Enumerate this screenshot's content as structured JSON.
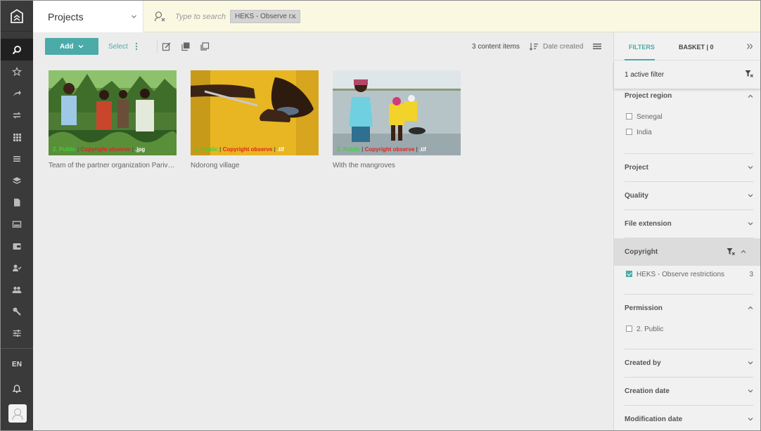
{
  "sidebar": {
    "icons": [
      "search-icon",
      "star-icon",
      "share-icon",
      "transfer-icon",
      "grid-icon",
      "list-icon",
      "layers-icon",
      "document-icon",
      "image-card-icon",
      "wallet-icon",
      "user-check-icon",
      "users-icon",
      "wrench-icon",
      "sliders-icon"
    ],
    "language": "EN"
  },
  "header": {
    "title": "Projects",
    "search_placeholder": "Type to search",
    "chip": "HEKS - Observe r..."
  },
  "toolbar": {
    "add_label": "Add",
    "select_label": "Select",
    "count_label": "3 content items",
    "sort_label": "Date created"
  },
  "gallery": [
    {
      "caption": "Team of the partner organization Parivarthan",
      "meta_g": "2. Public",
      "meta_r": "Copyright observe",
      "meta_w": ".jpg"
    },
    {
      "caption": "Ndorong village",
      "meta_g": "2. Public",
      "meta_r": "Copyright observe",
      "meta_w": ".tif"
    },
    {
      "caption": "With the mangroves",
      "meta_g": "2. Public",
      "meta_r": "Copyright observe",
      "meta_w": ".tif"
    }
  ],
  "panel": {
    "tab_filters": "FILTERS",
    "tab_basket": "BASKET | 0",
    "active_filter": "1 active filter",
    "sections": {
      "region": {
        "title": "Project region",
        "options": [
          "Senegal",
          "India"
        ]
      },
      "project": {
        "title": "Project"
      },
      "quality": {
        "title": "Quality"
      },
      "extension": {
        "title": "File extension"
      },
      "copyright": {
        "title": "Copyright",
        "option": "HEKS - Observe restrictions",
        "count": "3"
      },
      "permission": {
        "title": "Permission",
        "option": "2. Public"
      },
      "created_by": {
        "title": "Created by"
      },
      "creation_date": {
        "title": "Creation date"
      },
      "modification_date": {
        "title": "Modification date"
      }
    }
  },
  "colors": {
    "accent": "#4aaba9",
    "sidebar": "#3a3a3a",
    "topbar": "#fbf8e2"
  }
}
